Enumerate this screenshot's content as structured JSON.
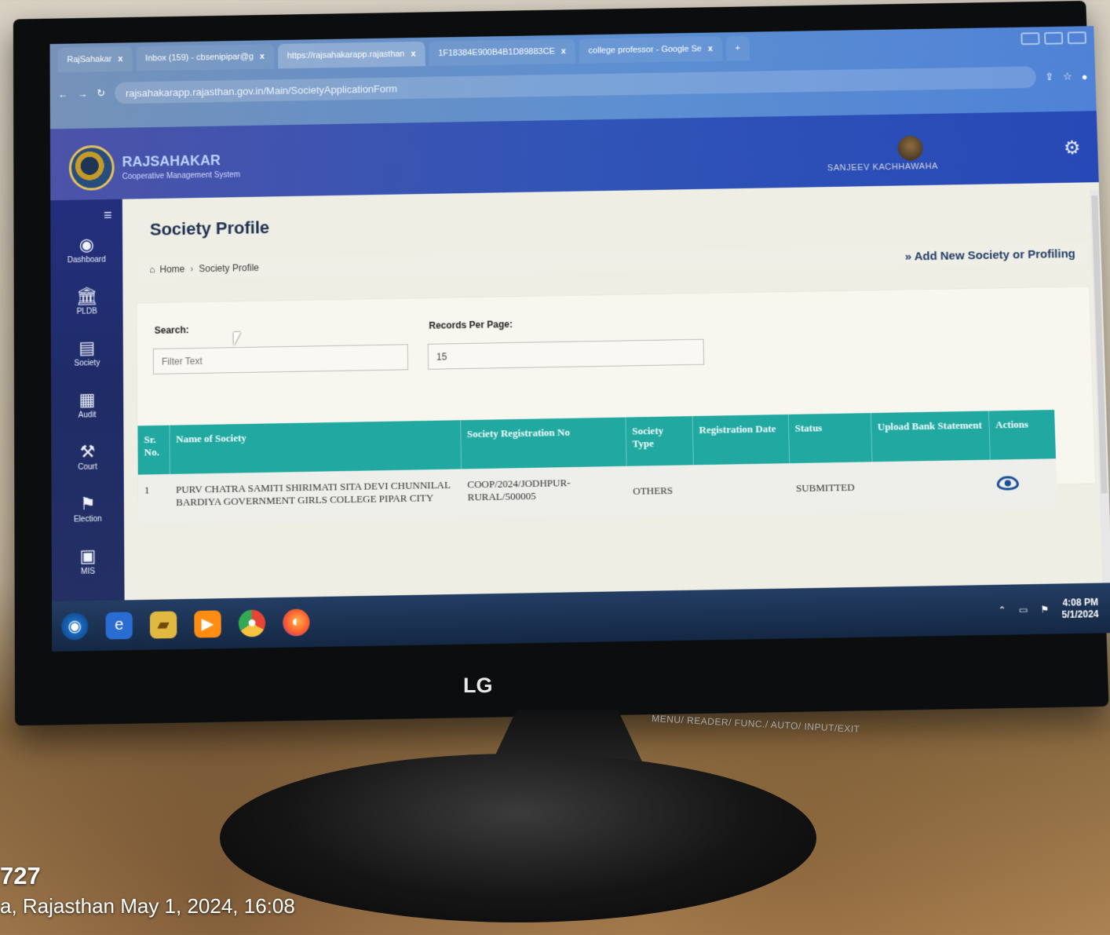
{
  "browser": {
    "tabs": [
      {
        "label": "RajSahakar",
        "close": "x",
        "active": false
      },
      {
        "label": "Inbox (159) - cbsenipipar@g",
        "close": "x",
        "active": false
      },
      {
        "label": "https://rajsahakarapp.rajasthan",
        "close": "x",
        "active": true
      },
      {
        "label": "1F18384E900B4B1D89883CE",
        "close": "x",
        "active": false
      },
      {
        "label": "college professor - Google Se",
        "close": "x",
        "active": false
      }
    ],
    "new_tab": "+",
    "address": "rajsahakarapp.rajasthan.gov.in/Main/SocietyApplicationForm"
  },
  "app": {
    "title": "RAJSAHAKAR",
    "subtitle": "Cooperative Management System",
    "user_name": "SANJEEV KACHHAWAHA",
    "menu_icon": "≡",
    "header_icon": "⚙"
  },
  "sidebar": {
    "items": [
      {
        "label": "Dashboard",
        "icon": "◉"
      },
      {
        "label": "PLDB",
        "icon": "🏛"
      },
      {
        "label": "Society",
        "icon": "▤"
      },
      {
        "label": "Audit",
        "icon": "▦"
      },
      {
        "label": "Court",
        "icon": "⚒"
      },
      {
        "label": "Election",
        "icon": "⚑"
      },
      {
        "label": "MIS",
        "icon": "▣"
      }
    ]
  },
  "page": {
    "title": "Society Profile",
    "breadcrumb": {
      "home": "Home",
      "separator": "›",
      "current": "Society Profile"
    },
    "add_link": "» Add New Society or Profiling"
  },
  "filters": {
    "search_label": "Search:",
    "search_placeholder": "Filter Text",
    "records_label": "Records Per Page:",
    "records_value": "15"
  },
  "table": {
    "headers": {
      "sr_no": "Sr. No.",
      "name": "Name of Society",
      "registration_no": "Society Registration No",
      "type": "Society Type",
      "registration_date": "Registration Date",
      "status": "Status",
      "upload_bank": "Upload Bank Statement",
      "actions": "Actions"
    },
    "rows": [
      {
        "sr_no": "1",
        "name": "PURV CHATRA SAMITI SHIRIMATI SITA DEVI CHUNNILAL BARDIYA GOVERNMENT GIRLS COLLEGE PIPAR CITY",
        "registration_no": "COOP/2024/JODHPUR-RURAL/500005",
        "type": "OTHERS",
        "registration_date": "",
        "status": "SUBMITTED",
        "upload_bank": ""
      }
    ]
  },
  "taskbar": {
    "time": "4:08 PM",
    "date": "5/1/2024"
  },
  "monitor": {
    "brand": "LG",
    "buttons": "MENU/ READER/ FUNC./ AUTO/ INPUT/EXIT"
  },
  "photo_stamp": {
    "code": "727",
    "location_date": "a, Rajasthan  May 1, 2024, 16:08"
  }
}
